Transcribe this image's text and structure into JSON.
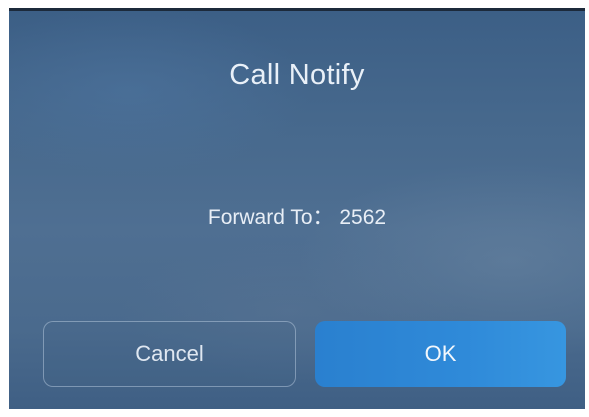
{
  "dialog": {
    "title": "Call Notify",
    "message": "Forward To： 2562",
    "cancel_label": "Cancel",
    "ok_label": "OK"
  },
  "colors": {
    "background": "#47698d",
    "ok_button": "#2f8ad9",
    "text": "#e9f0f8"
  }
}
